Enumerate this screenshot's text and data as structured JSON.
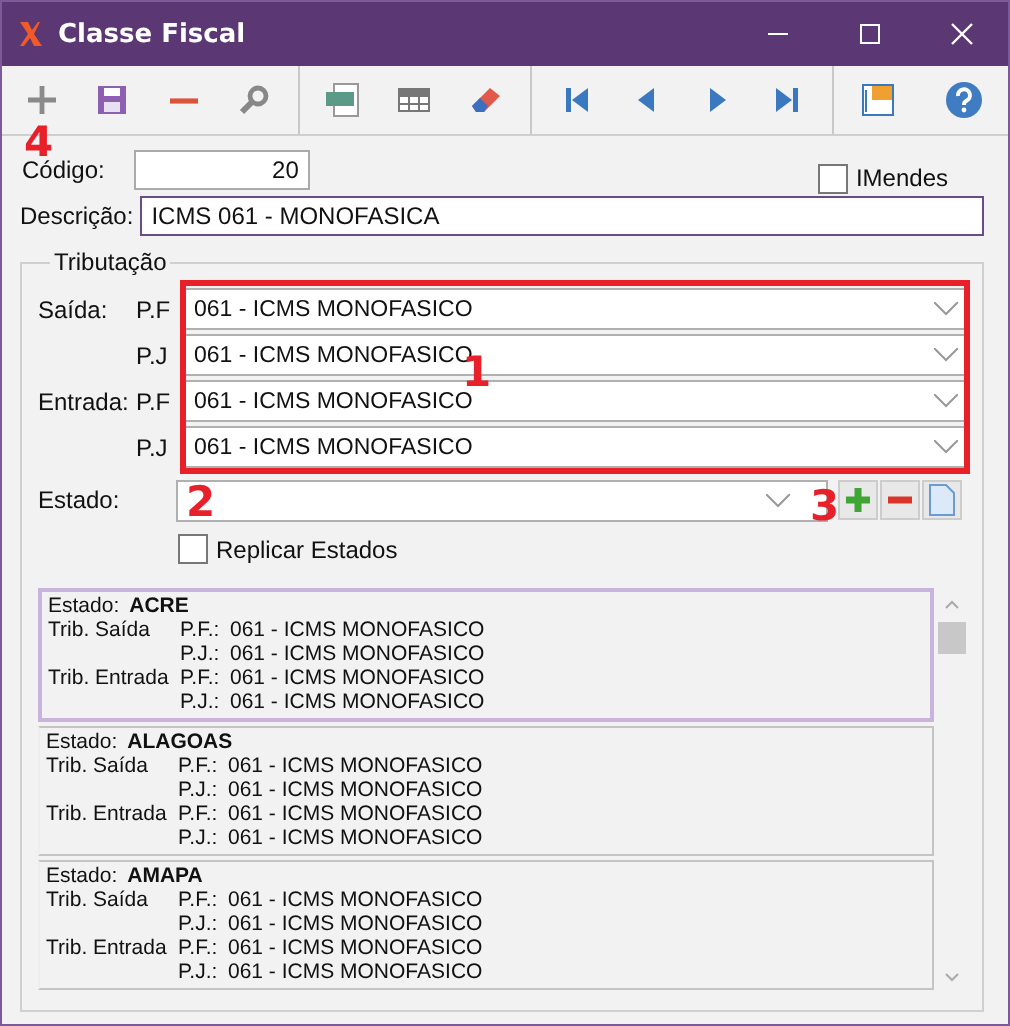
{
  "window": {
    "title": "Classe Fiscal"
  },
  "toolbar": {
    "annotation": "4"
  },
  "codigo": {
    "label": "Código:",
    "value": "20"
  },
  "imendes": {
    "label": "IMendes",
    "checked": false
  },
  "descricao": {
    "label": "Descrição:",
    "value": "ICMS 061 - MONOFASICA"
  },
  "tributacao": {
    "legend": "Tributação",
    "annotation": "1",
    "rows": [
      {
        "group": "Saída:",
        "person": "P.F",
        "value": "061 - ICMS MONOFASICO"
      },
      {
        "group": "",
        "person": "P.J",
        "value": "061 - ICMS MONOFASICO"
      },
      {
        "group": "Entrada:",
        "person": "P.F",
        "value": "061 - ICMS MONOFASICO"
      },
      {
        "group": "",
        "person": "P.J",
        "value": "061 - ICMS MONOFASICO"
      }
    ],
    "estado": {
      "label": "Estado:",
      "annotation": "2",
      "arrow_annotation": "3"
    },
    "replicar": {
      "label": "Replicar Estados",
      "checked": false
    },
    "states": [
      {
        "label": "Estado:",
        "name": "ACRE",
        "selected": true,
        "rows": [
          {
            "group": "Trib. Saída",
            "person": "P.F.:",
            "value": "061 - ICMS MONOFASICO"
          },
          {
            "group": "",
            "person": "P.J.:",
            "value": "061 - ICMS MONOFASICO"
          },
          {
            "group": "Trib. Entrada",
            "person": "P.F.:",
            "value": "061 - ICMS MONOFASICO"
          },
          {
            "group": "",
            "person": "P.J.:",
            "value": "061 - ICMS MONOFASICO"
          }
        ]
      },
      {
        "label": "Estado:",
        "name": "ALAGOAS",
        "selected": false,
        "rows": [
          {
            "group": "Trib. Saída",
            "person": "P.F.:",
            "value": "061 - ICMS MONOFASICO"
          },
          {
            "group": "",
            "person": "P.J.:",
            "value": "061 - ICMS MONOFASICO"
          },
          {
            "group": "Trib. Entrada",
            "person": "P.F.:",
            "value": "061 - ICMS MONOFASICO"
          },
          {
            "group": "",
            "person": "P.J.:",
            "value": "061 - ICMS MONOFASICO"
          }
        ]
      },
      {
        "label": "Estado:",
        "name": "AMAPA",
        "selected": false,
        "rows": [
          {
            "group": "Trib. Saída",
            "person": "P.F.:",
            "value": "061 - ICMS MONOFASICO"
          },
          {
            "group": "",
            "person": "P.J.:",
            "value": "061 - ICMS MONOFASICO"
          },
          {
            "group": "Trib. Entrada",
            "person": "P.F.:",
            "value": "061 - ICMS MONOFASICO"
          },
          {
            "group": "",
            "person": "P.J.:",
            "value": "061 - ICMS MONOFASICO"
          }
        ]
      }
    ]
  }
}
